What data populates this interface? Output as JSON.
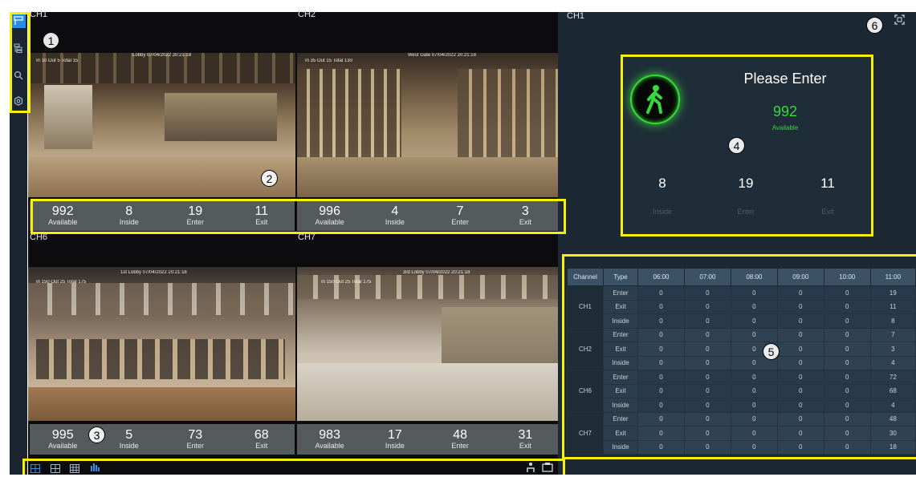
{
  "sidebar": {
    "items": [
      {
        "name": "people-count-icon",
        "active": true
      },
      {
        "name": "layout-tree-icon"
      },
      {
        "name": "search-icon"
      },
      {
        "name": "settings-icon"
      }
    ]
  },
  "channels": [
    {
      "label": "CH1",
      "osd_left": "In 10  Out 5  Total 15",
      "osd_right": "Lobby 07/04/2022  20:21:18",
      "stats": [
        {
          "value": "992",
          "label": "Available"
        },
        {
          "value": "8",
          "label": "Inside"
        },
        {
          "value": "19",
          "label": "Enter"
        },
        {
          "value": "11",
          "label": "Exit"
        }
      ]
    },
    {
      "label": "CH2",
      "osd_left": "In 35  Out 15  Total 130",
      "osd_right": "West Gate 07/04/2022  20:21:18",
      "stats": [
        {
          "value": "996",
          "label": "Available"
        },
        {
          "value": "4",
          "label": "Inside"
        },
        {
          "value": "7",
          "label": "Enter"
        },
        {
          "value": "3",
          "label": "Exit"
        }
      ]
    },
    {
      "label": "CH6",
      "osd_left": "In 150  Out 25  Total 175",
      "osd_right": "1st Lobby 07/04/2022  20:21:18",
      "stats": [
        {
          "value": "995",
          "label": "Available"
        },
        {
          "value": "5",
          "label": "Inside"
        },
        {
          "value": "73",
          "label": "Enter"
        },
        {
          "value": "68",
          "label": "Exit"
        }
      ]
    },
    {
      "label": "CH7",
      "osd_left": "In 150  Out 25  Total 175",
      "osd_right": "3rd Lobby 07/04/2022  20:21:18",
      "stats": [
        {
          "value": "983",
          "label": "Available"
        },
        {
          "value": "17",
          "label": "Inside"
        },
        {
          "value": "48",
          "label": "Enter"
        },
        {
          "value": "31",
          "label": "Exit"
        }
      ]
    }
  ],
  "bottom_bar": {
    "left_icons": [
      "layout-2x2-icon",
      "layout-3x3-icon",
      "layout-4x4-icon",
      "people-flow-icon"
    ],
    "right_icons": [
      "people-icon",
      "capture-icon"
    ]
  },
  "panel": {
    "channel": "CH1",
    "status_title": "Please Enter",
    "available_value": "992",
    "available_label": "Available",
    "inside_value": "8",
    "inside_label": "Inside",
    "enter_value": "19",
    "enter_label": "Enter",
    "exit_value": "11",
    "exit_label": "Exit",
    "status_color": "#36d93a",
    "fullscreen_icon": "fullscreen-icon"
  },
  "table": {
    "headers": [
      "Channel",
      "Type",
      "06:00",
      "07:00",
      "08:00",
      "09:00",
      "10:00",
      "11:00"
    ],
    "groups": [
      {
        "channel": "CH1",
        "rows": [
          {
            "type": "Enter",
            "values": [
              "0",
              "0",
              "0",
              "0",
              "0",
              "19"
            ]
          },
          {
            "type": "Exit",
            "values": [
              "0",
              "0",
              "0",
              "0",
              "0",
              "11"
            ]
          },
          {
            "type": "Inside",
            "values": [
              "0",
              "0",
              "0",
              "0",
              "0",
              "8"
            ]
          }
        ]
      },
      {
        "channel": "CH2",
        "rows": [
          {
            "type": "Enter",
            "values": [
              "0",
              "0",
              "0",
              "0",
              "0",
              "7"
            ]
          },
          {
            "type": "Exit",
            "values": [
              "0",
              "0",
              "0",
              "0",
              "0",
              "3"
            ]
          },
          {
            "type": "Inside",
            "values": [
              "0",
              "0",
              "0",
              "0",
              "0",
              "4"
            ]
          }
        ]
      },
      {
        "channel": "CH6",
        "rows": [
          {
            "type": "Enter",
            "values": [
              "0",
              "0",
              "0",
              "0",
              "0",
              "72"
            ]
          },
          {
            "type": "Exit",
            "values": [
              "0",
              "0",
              "0",
              "0",
              "0",
              "68"
            ]
          },
          {
            "type": "Inside",
            "values": [
              "0",
              "0",
              "0",
              "0",
              "0",
              "4"
            ]
          }
        ]
      },
      {
        "channel": "CH7",
        "rows": [
          {
            "type": "Enter",
            "values": [
              "0",
              "0",
              "0",
              "0",
              "0",
              "48"
            ]
          },
          {
            "type": "Exit",
            "values": [
              "0",
              "0",
              "0",
              "0",
              "0",
              "30"
            ]
          },
          {
            "type": "Inside",
            "values": [
              "0",
              "0",
              "0",
              "0",
              "0",
              "18"
            ]
          }
        ]
      }
    ]
  },
  "annotations": [
    "1",
    "2",
    "3",
    "4",
    "5",
    "6"
  ],
  "colors": {
    "highlight": "#f6ef0e",
    "accent_blue": "#2d8fe8",
    "panel_bg": "#1c2833",
    "stats_bg": "#555a5c"
  }
}
